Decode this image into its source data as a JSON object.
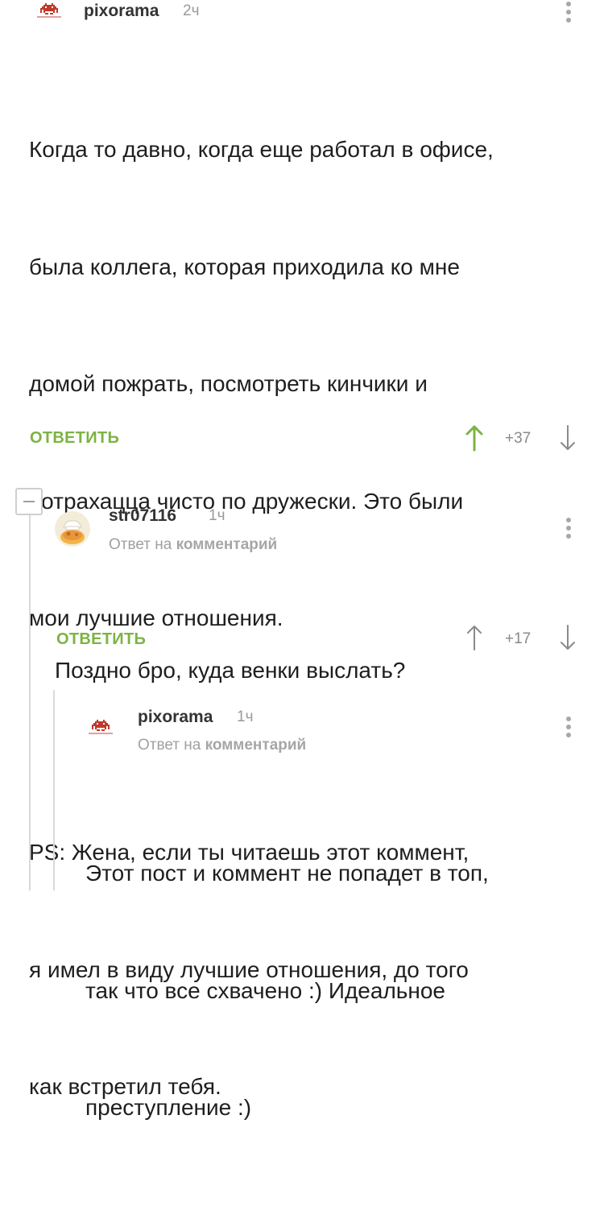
{
  "comments": [
    {
      "username": "pixorama",
      "time": "2ч",
      "reply_to": null,
      "text_lines": [
        "Когда то давно, когда еще работал в офисе,",
        "была коллега, которая приходила ко мне",
        "домой пожрать, посмотреть кинчики и",
        "потрахацца чисто по дружески. Это были",
        "мои лучшие отношения.",
        "",
        "PS: Жена, если ты читаешь этот коммент,",
        "я имел в виду лучшие отношения, до того",
        "как встретил тебя."
      ],
      "reply_label": "ОТВЕТИТЬ",
      "score": "+37",
      "upvote_color": "#7cb342"
    },
    {
      "username": "str07116",
      "time": "1ч",
      "reply_to": {
        "prefix": "Ответ на",
        "target": "комментарий"
      },
      "text_lines": [
        "Поздно бро, куда венки выслать?"
      ],
      "reply_label": "ОТВЕТИТЬ",
      "score": "+17"
    },
    {
      "username": "pixorama",
      "time": "1ч",
      "reply_to": {
        "prefix": "Ответ на",
        "target": "комментарий"
      },
      "text_lines": [
        "Этот пост и коммент не попадет в топ,",
        "так что все схвачено :) Идеальное",
        "преступление :)"
      ]
    }
  ],
  "icons": {
    "upvote": "arrow-up-icon",
    "downvote": "arrow-down-icon",
    "menu": "more-vertical-icon",
    "collapse": "minus-icon"
  },
  "colors": {
    "accent_green": "#7cb342",
    "muted": "#9a9a9a"
  }
}
